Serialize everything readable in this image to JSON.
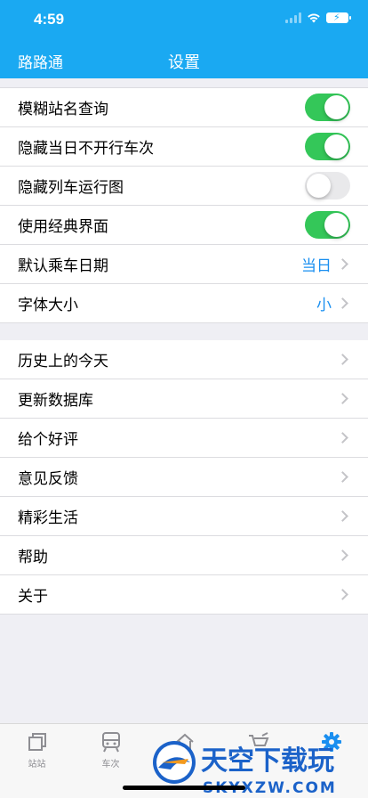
{
  "status_bar": {
    "time": "4:59"
  },
  "nav": {
    "back_title": "路路通",
    "title": "设置"
  },
  "section1": [
    {
      "label": "模糊站名查询",
      "type": "toggle",
      "on": true
    },
    {
      "label": "隐藏当日不开行车次",
      "type": "toggle",
      "on": true
    },
    {
      "label": "隐藏列车运行图",
      "type": "toggle",
      "on": false
    },
    {
      "label": "使用经典界面",
      "type": "toggle",
      "on": true
    },
    {
      "label": "默认乘车日期",
      "type": "value",
      "value": "当日"
    },
    {
      "label": "字体大小",
      "type": "value",
      "value": "小"
    }
  ],
  "section2": [
    {
      "label": "历史上的今天"
    },
    {
      "label": "更新数据库"
    },
    {
      "label": "给个好评"
    },
    {
      "label": "意见反馈"
    },
    {
      "label": "精彩生活"
    },
    {
      "label": "帮助"
    },
    {
      "label": "关于"
    }
  ],
  "tabbar": {
    "tabs": [
      {
        "label": "站站",
        "icon": "stack-icon"
      },
      {
        "label": "车次",
        "icon": "train-icon"
      },
      {
        "label": "",
        "icon": "home-icon"
      },
      {
        "label": "",
        "icon": "cart-icon"
      },
      {
        "label": "",
        "icon": "gear-icon",
        "active": true
      }
    ]
  },
  "watermark": {
    "text": "天空下载玩",
    "sub": "SKYXZW.COM"
  },
  "colors": {
    "header": "#1aa9f2",
    "toggle_on": "#34c759",
    "accent": "#1a8ff0"
  }
}
